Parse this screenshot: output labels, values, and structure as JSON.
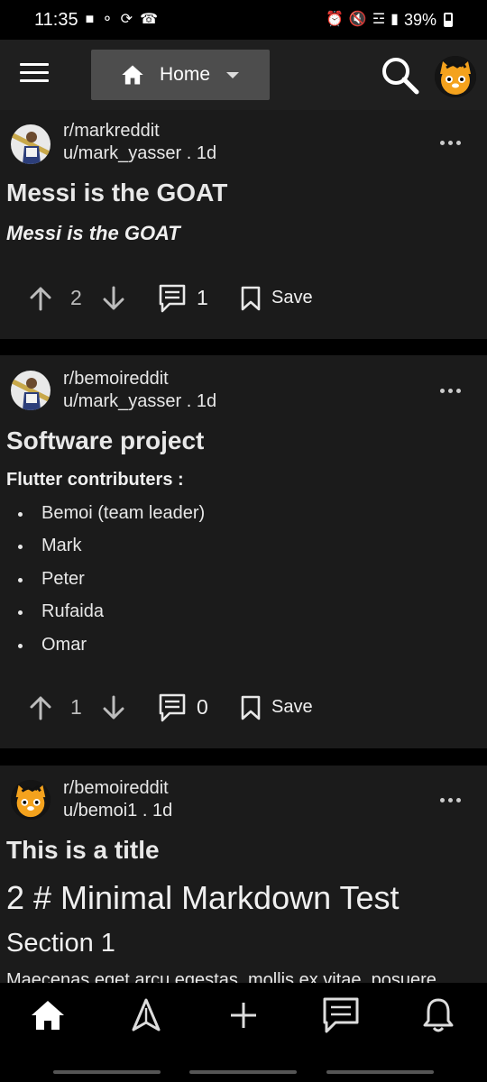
{
  "status_bar": {
    "time": "11:35",
    "battery": "39%"
  },
  "header": {
    "feed_selector_label": "Home"
  },
  "posts": [
    {
      "subreddit": "r/markreddit",
      "author_line": "u/mark_yasser . 1d",
      "title": "Messi is the GOAT",
      "body_italic": "Messi is the GOAT",
      "vote_count": "2",
      "comment_count": "1",
      "save_label": "Save"
    },
    {
      "subreddit": "r/bemoireddit",
      "author_line": "u/mark_yasser . 1d",
      "title": "Software project",
      "body_heading": "Flutter contributers :",
      "bullets": [
        "Bemoi (team leader)",
        "Mark",
        "Peter",
        "Rufaida",
        "Omar"
      ],
      "vote_count": "1",
      "comment_count": "0",
      "save_label": "Save"
    },
    {
      "subreddit": "r/bemoireddit",
      "author_line": "u/bemoi1 . 1d",
      "title": "This is a title",
      "md_h1": "2 # Minimal Markdown Test",
      "md_h2": "Section 1",
      "md_para": "Maecenas eget arcu egestas, mollis ex vitae, posuere"
    }
  ],
  "bottom_nav": {
    "items": [
      "home-icon",
      "discover-icon",
      "add-icon",
      "chat-icon",
      "bell-icon"
    ]
  },
  "colors": {
    "card_bg": "#1b1b1b",
    "app_bar_bg": "#1f1f1f",
    "dropdown_bg": "#4d4d4d",
    "avatar_orange": "#f4a21d"
  }
}
